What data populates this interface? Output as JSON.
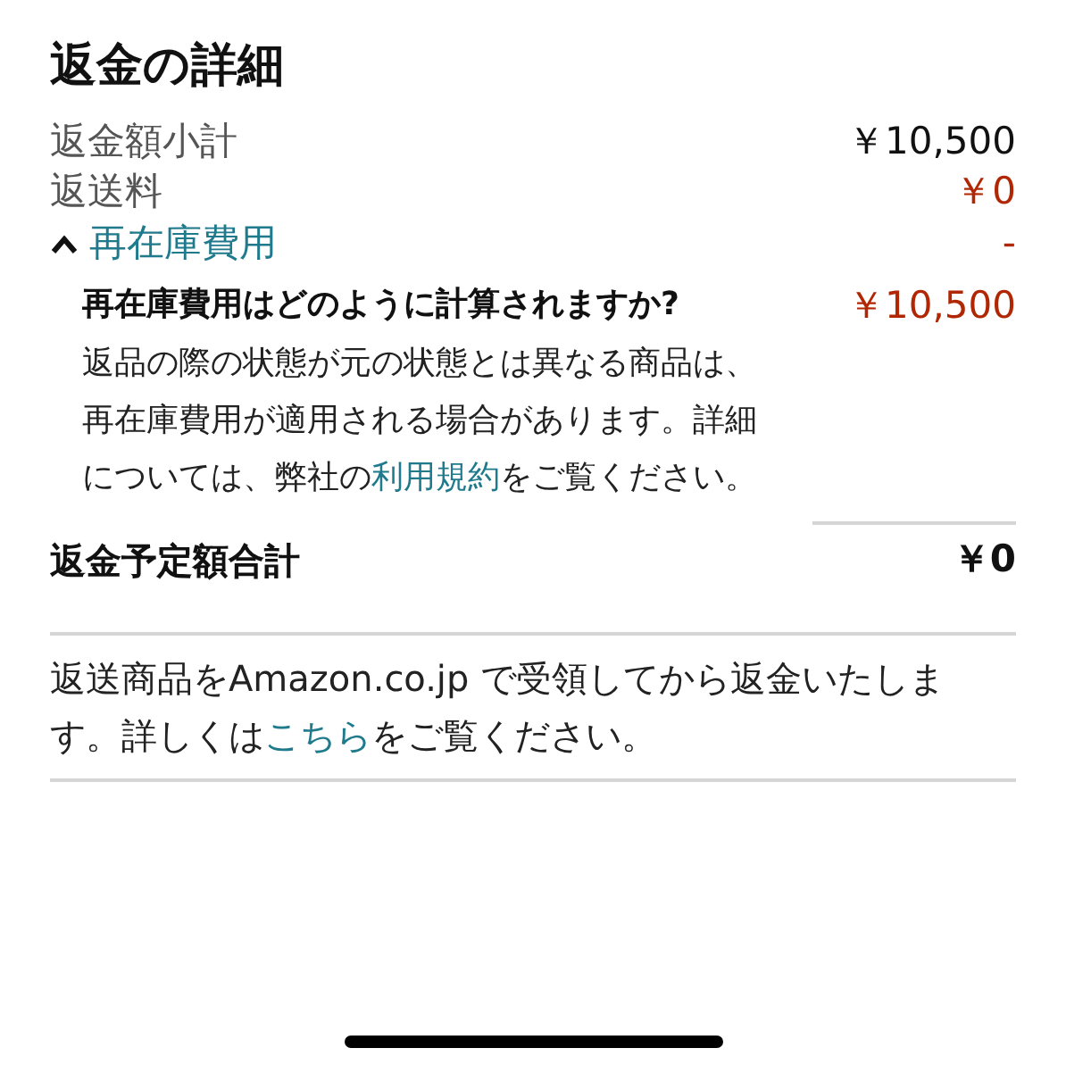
{
  "title": "返金の詳細",
  "rows": [
    {
      "label": "返金額小計",
      "value": "￥10,500",
      "kind": "amount"
    },
    {
      "label": "返送料",
      "value": "￥0",
      "kind": "deduction"
    }
  ],
  "restocking": {
    "label": "再在庫費用",
    "expanded": true,
    "value": "-",
    "question": "再在庫費用はどのように計算されますか?",
    "fee": "￥10,500",
    "text_before": "返品の際の状態が元の状態とは異なる商品は、再在庫費用が適用される場合があります。詳細については、弊社の",
    "link": "利用規約",
    "text_after": "をご覧ください。"
  },
  "total": {
    "label": "返金予定額合計",
    "value": "￥0"
  },
  "note": {
    "text_before": "返送商品をAmazon.co.jp で受領してから返金いたします。詳しくは",
    "link": "こちら",
    "text_after": "をご覧ください。"
  }
}
